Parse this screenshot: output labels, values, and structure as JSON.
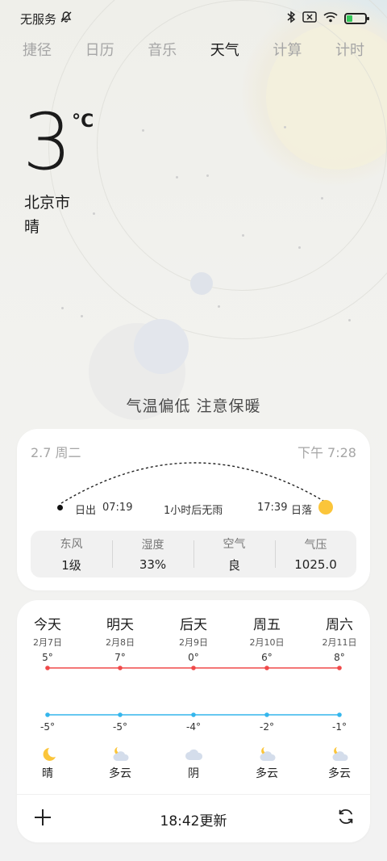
{
  "status": {
    "network": "无服务",
    "icons": [
      "mute-icon",
      "bluetooth-icon",
      "sim-error-icon",
      "wifi-icon",
      "battery-charging-icon"
    ]
  },
  "tabs": [
    {
      "label": "捷径",
      "active": false
    },
    {
      "label": "日历",
      "active": false
    },
    {
      "label": "音乐",
      "active": false
    },
    {
      "label": "天气",
      "active": true
    },
    {
      "label": "计算",
      "active": false
    },
    {
      "label": "计时",
      "active": false
    }
  ],
  "current": {
    "temp": "3",
    "unit": "°C",
    "city": "北京市",
    "condition": "晴",
    "advice": "气温偏低 注意保暖"
  },
  "sun_card": {
    "date": "2.7 周二",
    "time": "下午 7:28",
    "sunrise_label": "日出",
    "sunrise_time": "07:19",
    "rain_note": "1小时后无雨",
    "sunset_time": "17:39",
    "sunset_label": "日落",
    "metrics": [
      {
        "label": "东风",
        "value": "1级"
      },
      {
        "label": "湿度",
        "value": "33%"
      },
      {
        "label": "空气",
        "value": "良"
      },
      {
        "label": "气压",
        "value": "1025.0"
      }
    ]
  },
  "forecast": {
    "days": [
      {
        "name": "今天",
        "date": "2月7日",
        "high": "5°",
        "low": "-5°",
        "condition": "晴",
        "icon": "moon-icon"
      },
      {
        "name": "明天",
        "date": "2月8日",
        "high": "7°",
        "low": "-5°",
        "condition": "多云",
        "icon": "moon-cloud-icon"
      },
      {
        "name": "后天",
        "date": "2月9日",
        "high": "0°",
        "low": "-4°",
        "condition": "阴",
        "icon": "cloud-icon"
      },
      {
        "name": "周五",
        "date": "2月10日",
        "high": "6°",
        "low": "-2°",
        "condition": "多云",
        "icon": "moon-cloud-icon"
      },
      {
        "name": "周六",
        "date": "2月11日",
        "high": "8°",
        "low": "-1°",
        "condition": "多云",
        "icon": "moon-cloud-icon"
      }
    ],
    "high_color": "#f04a4a",
    "low_color": "#35b6ec",
    "update_text": "18:42更新"
  }
}
